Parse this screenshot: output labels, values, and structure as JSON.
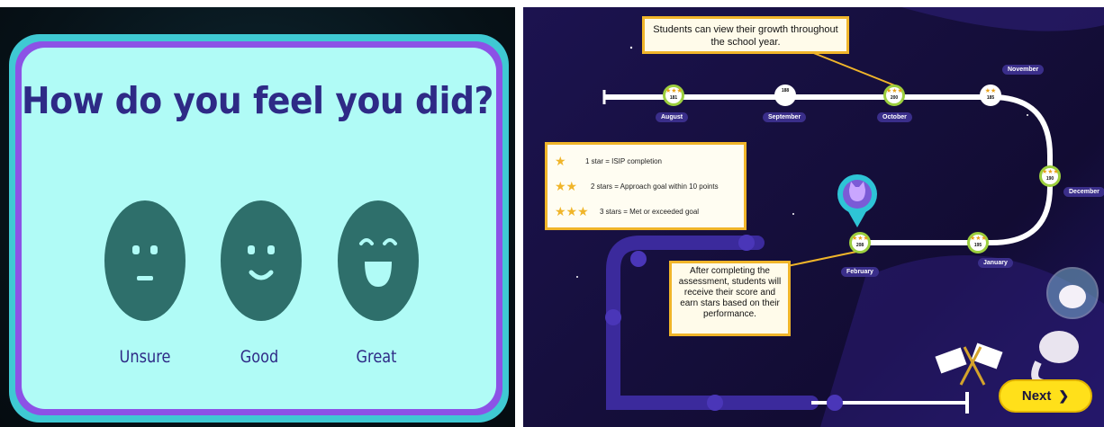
{
  "left_panel": {
    "question": "How do you feel you did?",
    "options": [
      {
        "label": "Unsure",
        "icon": "neutral-face-icon"
      },
      {
        "label": "Good",
        "icon": "smile-face-icon"
      },
      {
        "label": "Great",
        "icon": "laughing-face-icon"
      }
    ]
  },
  "right_panel": {
    "top_callout": "Students can view their growth throughout the school year.",
    "bottom_callout": "After completing the assessment, students will receive their score and earn stars based on their performance.",
    "legend": [
      {
        "stars": "★",
        "text": "1 star = ISIP completion"
      },
      {
        "stars": "★★",
        "text": "2 stars = Approach goal within 10 points"
      },
      {
        "stars": "★★★",
        "text": "3 stars = Met or exceeded goal"
      }
    ],
    "months": [
      {
        "label": "August",
        "score": "181",
        "stars": "★★★"
      },
      {
        "label": "September",
        "score": "188",
        "stars": ""
      },
      {
        "label": "October",
        "score": "200",
        "stars": "★★★"
      },
      {
        "label": "November",
        "score": "185",
        "stars": "★★"
      },
      {
        "label": "December",
        "score": "190",
        "stars": "★★★"
      },
      {
        "label": "January",
        "score": "195",
        "stars": "★★★"
      },
      {
        "label": "February",
        "score": "208",
        "stars": "★★★"
      }
    ],
    "next_label": "Next",
    "next_icon": "chevron-right-icon",
    "colors": {
      "gold": "#f0b52a",
      "path": "#ffffff",
      "node_border": "#9ccf3e",
      "next": "#ffe01a"
    }
  }
}
